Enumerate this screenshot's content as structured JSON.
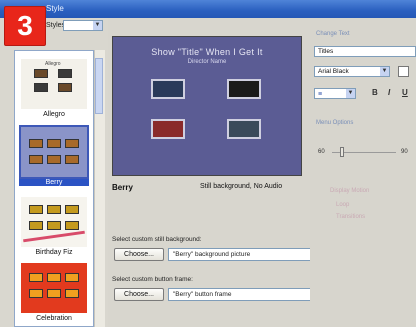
{
  "step_badge": "3",
  "window": {
    "title": "Style"
  },
  "left": {
    "styles_label": "Styles:",
    "styles": [
      {
        "name": "Allegro"
      },
      {
        "name": "Berry"
      },
      {
        "name": "Birthday Fiz"
      },
      {
        "name": "Celebration"
      }
    ],
    "allegro_thumb_text": "Allegro"
  },
  "preview": {
    "title": "Show \"Title\" When I Get It",
    "subtitle": "Director Name"
  },
  "style_name": "Berry",
  "style_description": "Still background, No Audio",
  "background": {
    "label": "Select custom still background:",
    "choose": "Choose...",
    "value": "\"Berry\" background picture"
  },
  "button_frame": {
    "label": "Select custom button frame:",
    "choose": "Choose...",
    "value": "\"Berry\" button frame"
  },
  "right": {
    "change_text_label": "Change Text",
    "text_type": "Titles",
    "font": "Arial Black",
    "format_buttons": [
      "B",
      "I",
      "U"
    ],
    "menu_options_label": "Menu Options",
    "slider_min": "60",
    "slider_max": "90",
    "faint_lines": [
      "Display Motion",
      "Loop",
      "Transitions"
    ]
  }
}
